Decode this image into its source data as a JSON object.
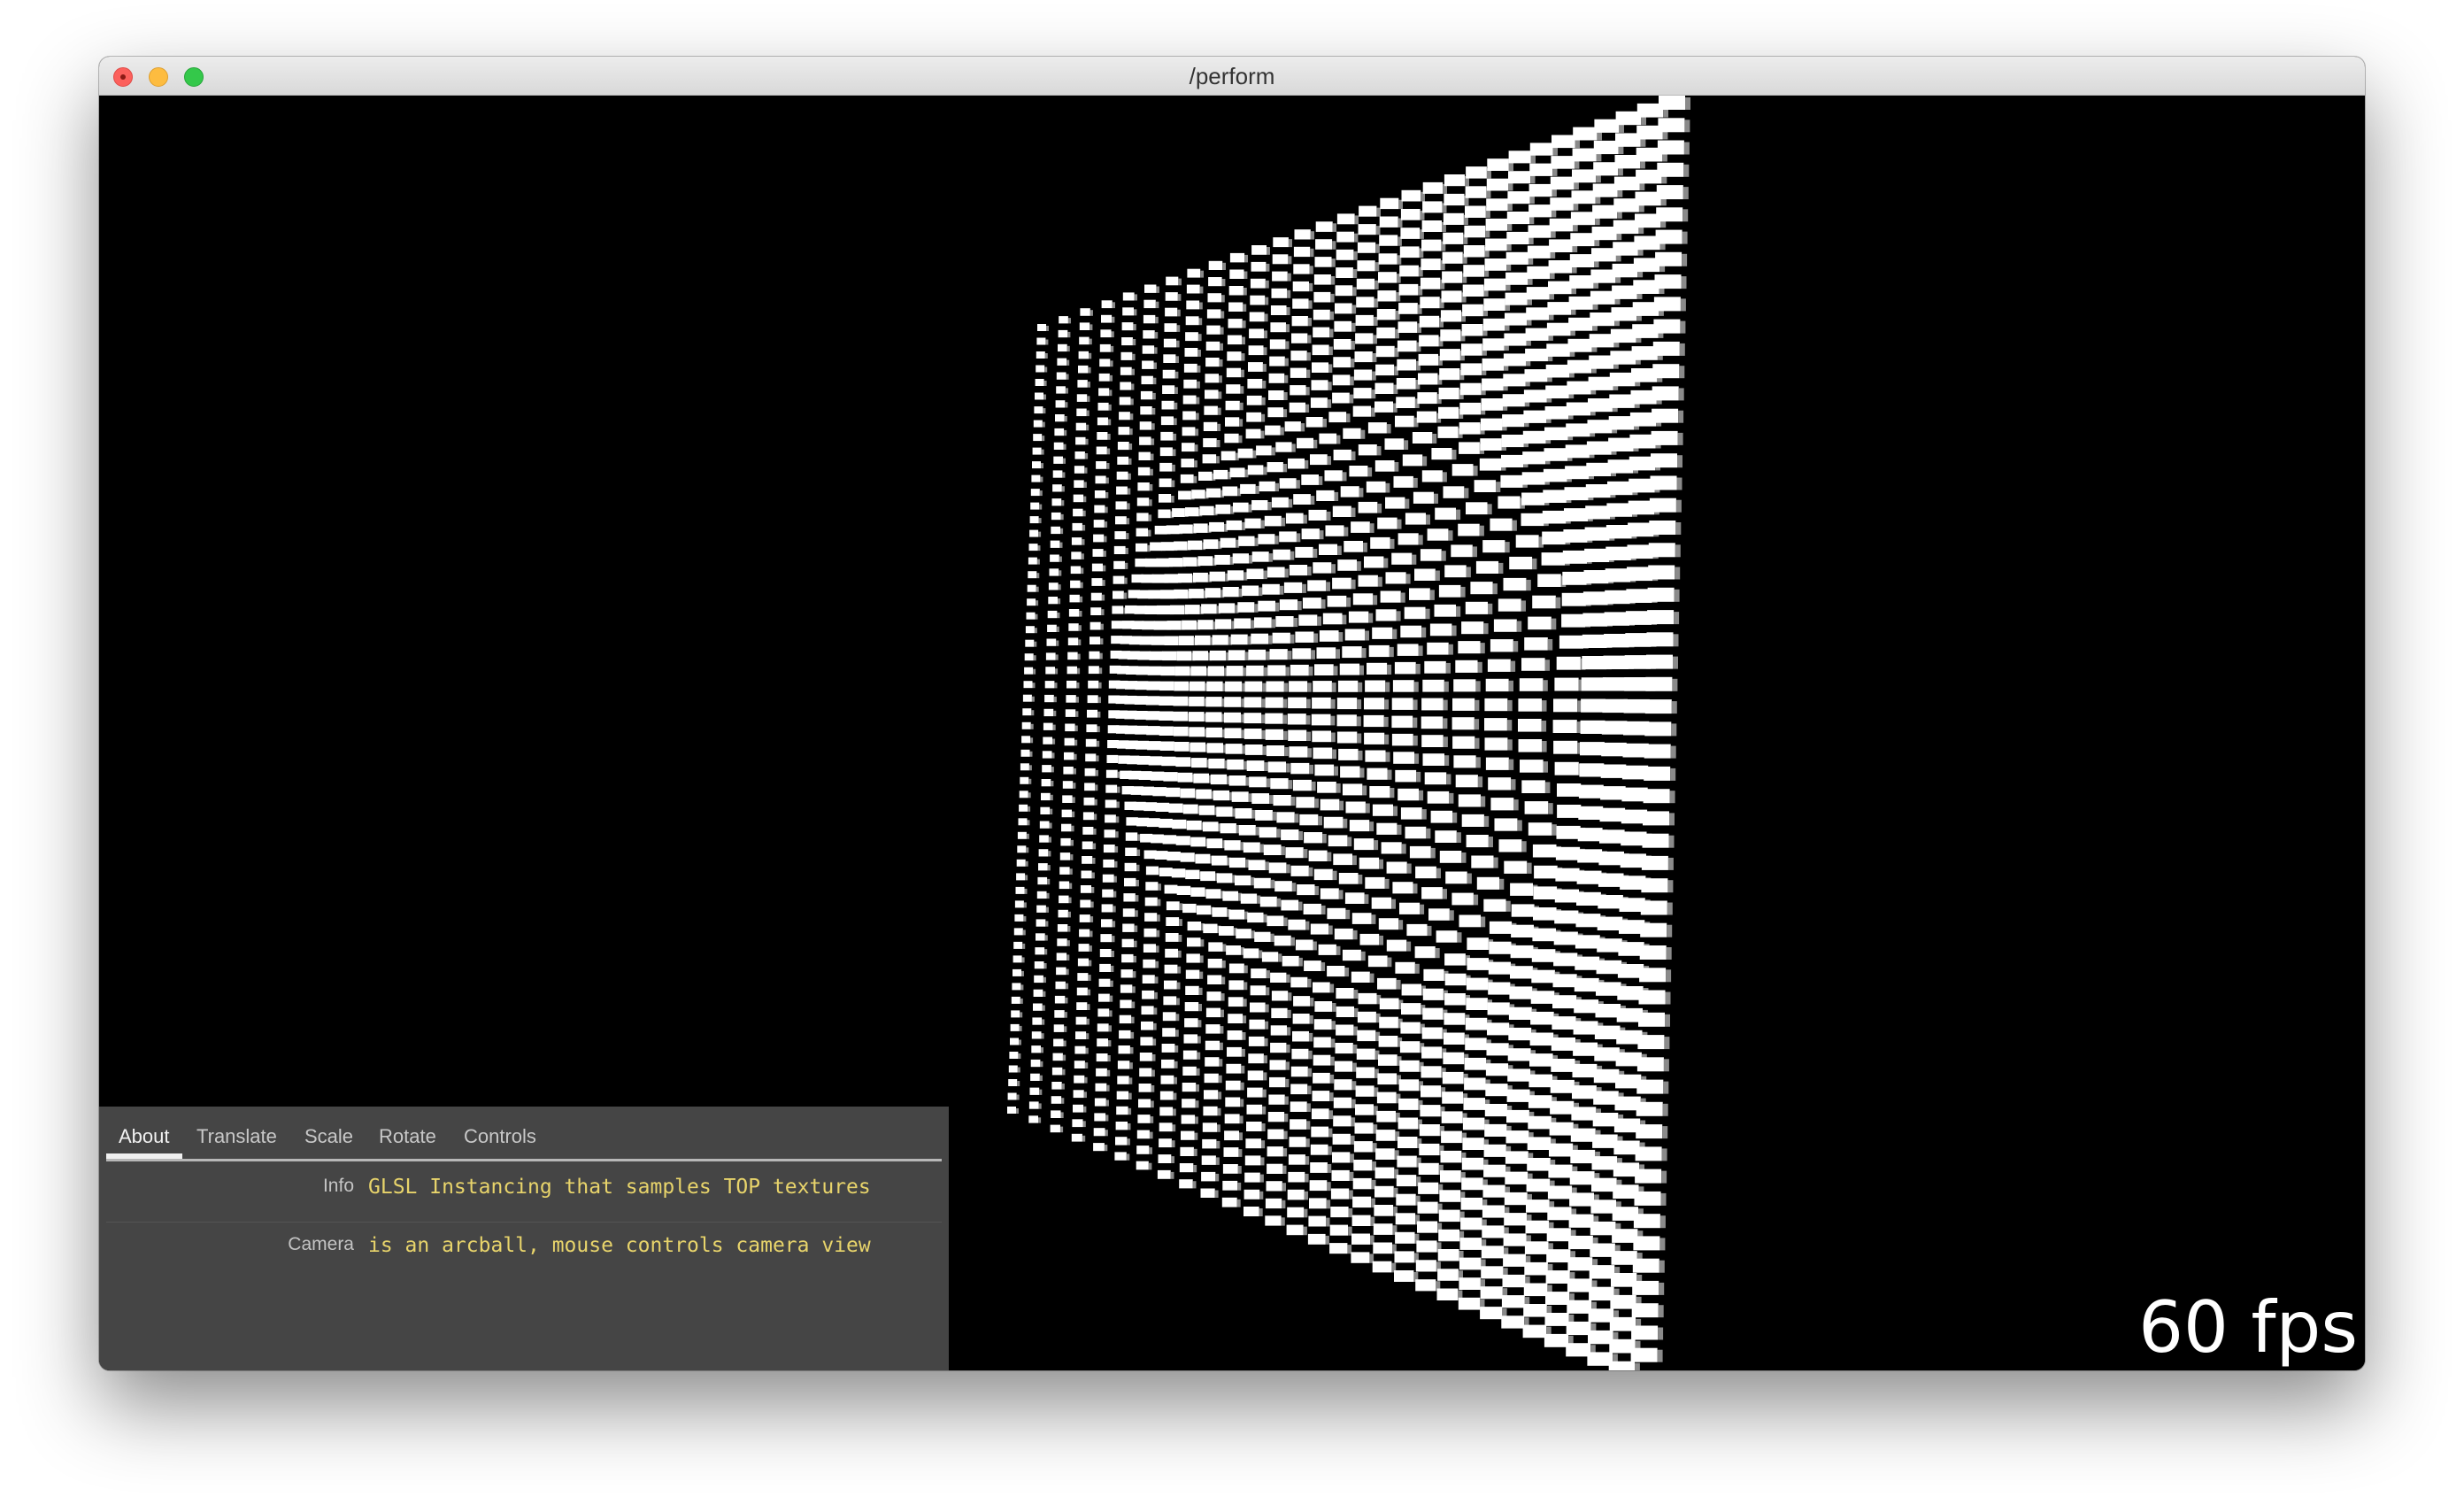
{
  "window": {
    "title": "/perform"
  },
  "panel": {
    "tabs": [
      {
        "label": "About",
        "active": true
      },
      {
        "label": "Translate",
        "active": false
      },
      {
        "label": "Scale",
        "active": false
      },
      {
        "label": "Rotate",
        "active": false
      },
      {
        "label": "Controls",
        "active": false
      }
    ],
    "rows": [
      {
        "label": "Info",
        "value": "GLSL Instancing that samples TOP textures"
      },
      {
        "label": "Camera",
        "value": "is an arcball, mouse controls camera view"
      }
    ]
  },
  "viewport": {
    "fps": "60 fps",
    "scene": "instanced-cube-grid"
  },
  "colors": {
    "background": "#000000",
    "panel": "#454545",
    "value_text": "#e8d46b",
    "label_text": "#c4c4c4",
    "instance": "#ffffff"
  }
}
